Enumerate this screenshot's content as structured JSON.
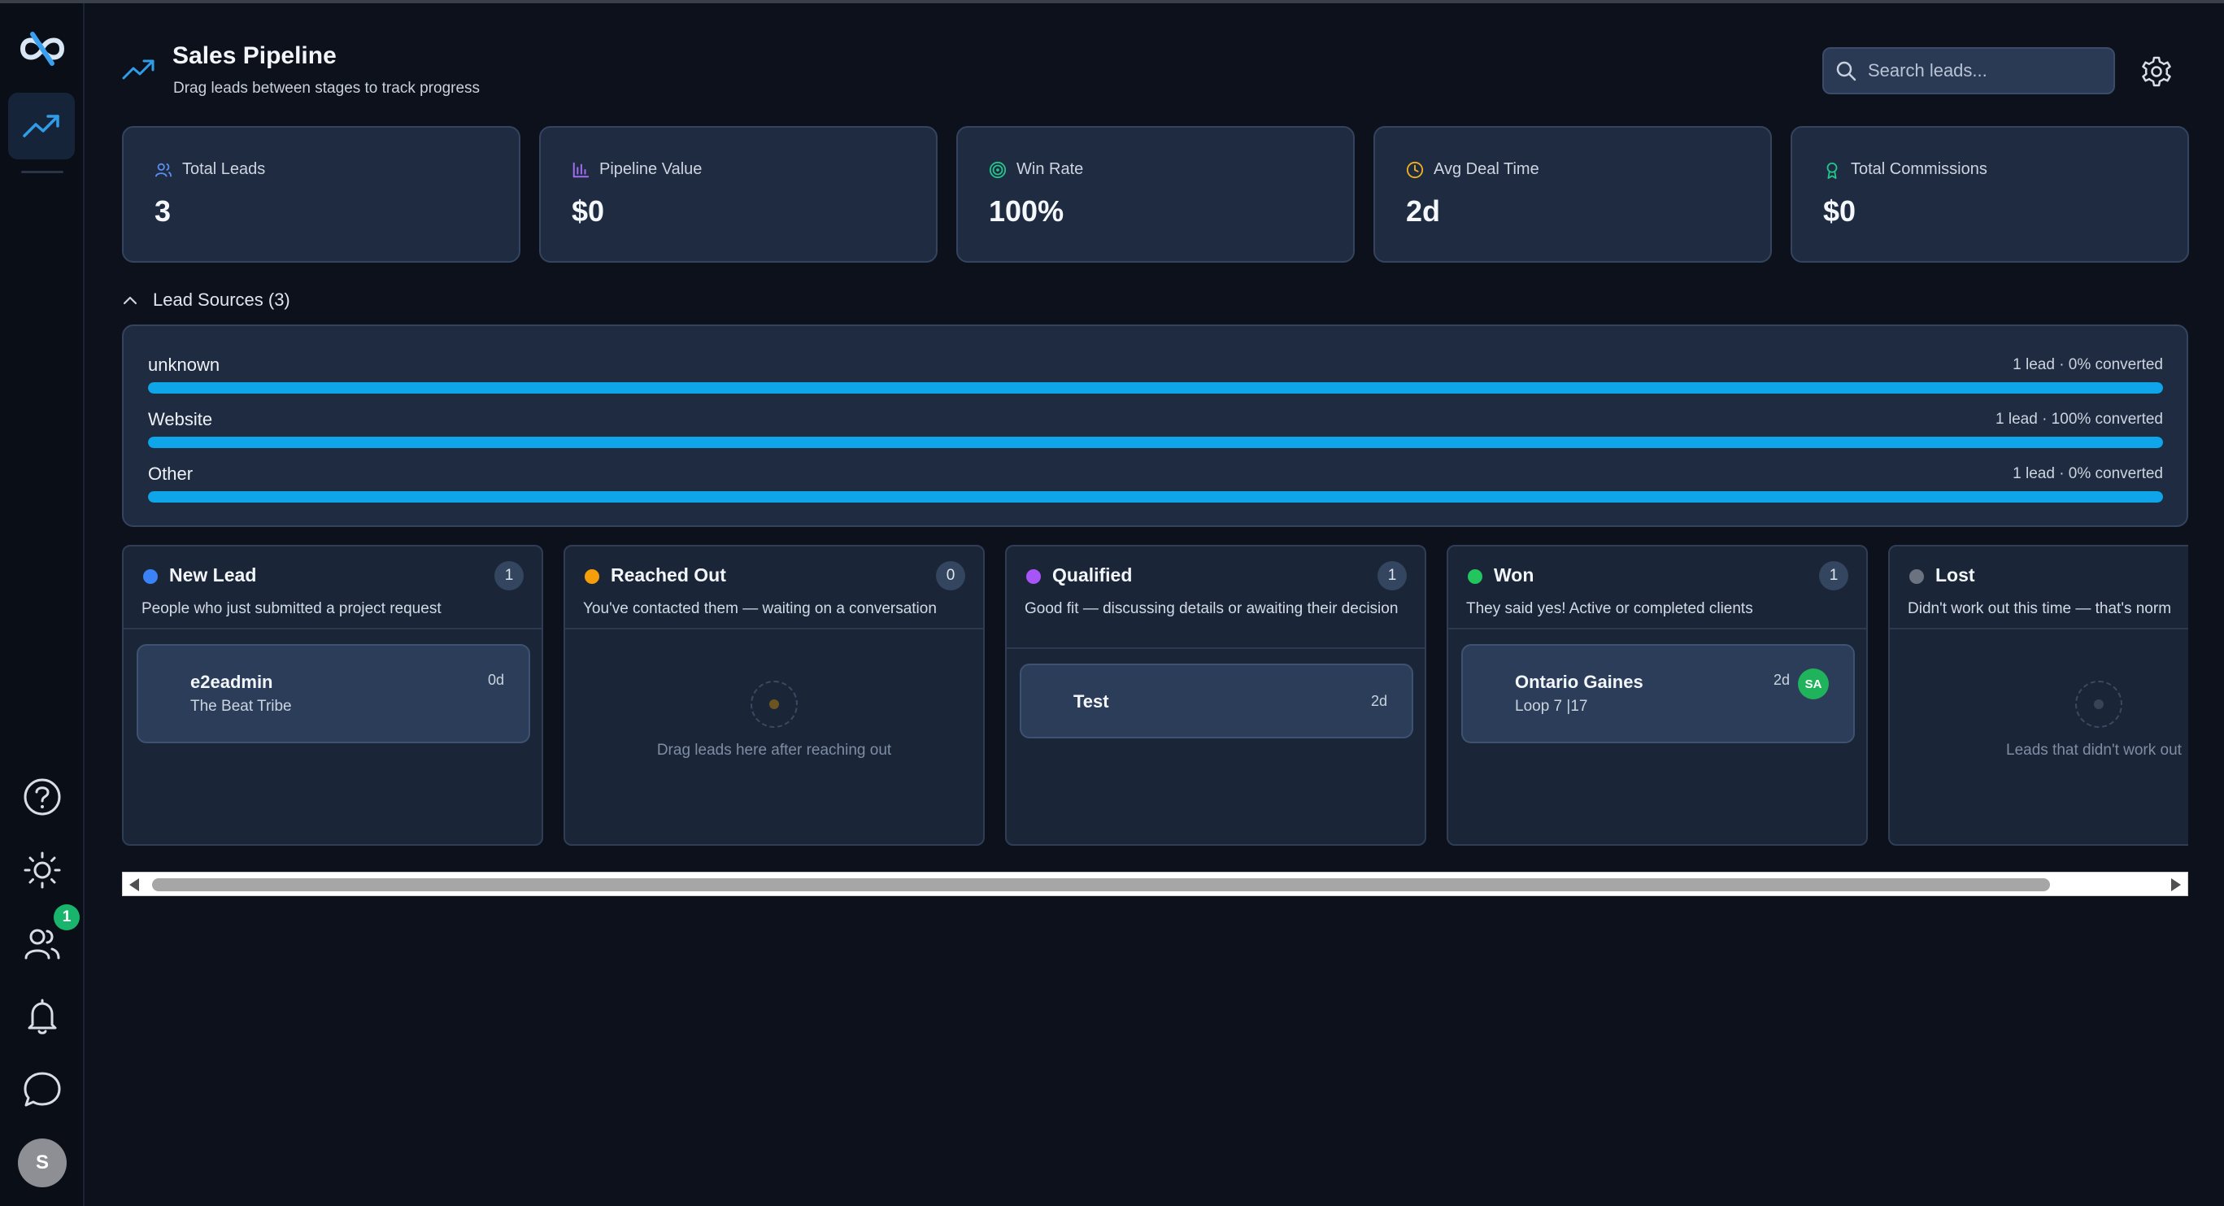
{
  "header": {
    "title": "Sales Pipeline",
    "subtitle": "Drag leads between stages to track progress",
    "search_placeholder": "Search leads..."
  },
  "sidebar": {
    "nav_items": [
      "pipeline-icon",
      "help-icon",
      "theme-sun-icon",
      "users-icon",
      "bell-icon",
      "chat-icon"
    ],
    "users_badge": "1",
    "avatar_initial": "S"
  },
  "stats": [
    {
      "label": "Total Leads",
      "value": "3",
      "icon": "users-icon",
      "color": "#5b8def"
    },
    {
      "label": "Pipeline Value",
      "value": "$0",
      "icon": "bar-chart-icon",
      "color": "#a06cf0"
    },
    {
      "label": "Win Rate",
      "value": "100%",
      "icon": "target-icon",
      "color": "#22c58b"
    },
    {
      "label": "Avg Deal Time",
      "value": "2d",
      "icon": "clock-icon",
      "color": "#f2b01e"
    },
    {
      "label": "Total Commissions",
      "value": "$0",
      "icon": "award-icon",
      "color": "#22c58b"
    }
  ],
  "lead_sources": {
    "toggle_label": "Lead Sources (3)",
    "rows": [
      {
        "name": "unknown",
        "stat": "1 lead · 0% converted",
        "share": 1.0
      },
      {
        "name": "Website",
        "stat": "1 lead · 100% converted",
        "share": 1.0
      },
      {
        "name": "Other",
        "stat": "1 lead · 0% converted",
        "share": 1.0
      }
    ]
  },
  "columns": [
    {
      "title": "New Lead",
      "count": "1",
      "color": "#3b82f6",
      "description": "People who just submitted a project request",
      "cards": [
        {
          "name": "e2eadmin",
          "sub": "The Beat Tribe",
          "age": "0d"
        }
      ]
    },
    {
      "title": "Reached Out",
      "count": "0",
      "color": "#f59e0b",
      "description": "You've contacted them — waiting on a conversation",
      "empty_text": "Drag leads here after reaching out"
    },
    {
      "title": "Qualified",
      "count": "1",
      "color": "#a855f7",
      "description": "Good fit — discussing details or awaiting their decision",
      "cards": [
        {
          "name": "Test",
          "age": "2d"
        }
      ]
    },
    {
      "title": "Won",
      "count": "1",
      "color": "#22c55e",
      "description": "They said yes! Active or completed clients",
      "cards": [
        {
          "name": "Ontario Gaines",
          "sub": "Loop 7 |17",
          "age": "2d",
          "avatar": "SA"
        }
      ]
    },
    {
      "title": "Lost",
      "color": "#6b7280",
      "description": "Didn't work out this time — that's norm",
      "empty_text": "Leads that didn't work out"
    }
  ]
}
